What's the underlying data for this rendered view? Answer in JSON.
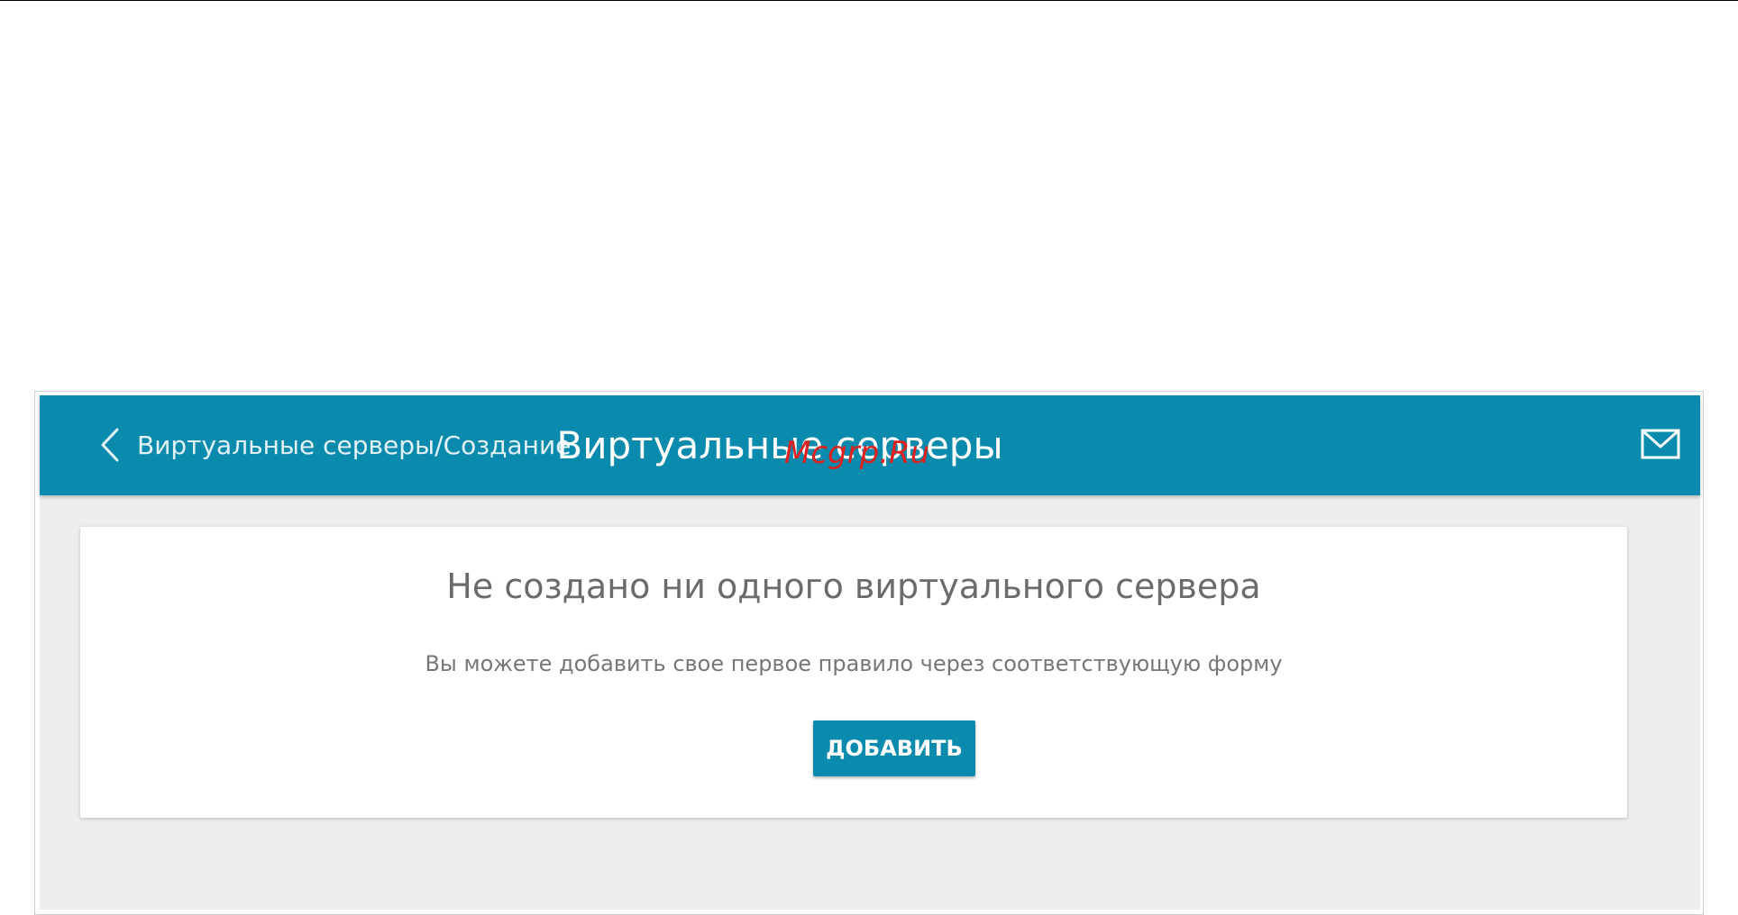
{
  "header": {
    "back_label": "Виртуальные серверы/Создание",
    "title": "Виртуальные серверы",
    "watermark": "Mcgrp.Ru",
    "icons": {
      "back": "chevron-left-icon",
      "mail": "mail-icon"
    }
  },
  "empty_state": {
    "title": "Не создано ни одного виртуального сервера",
    "description": "Вы можете добавить свое первое правило через соответствующую форму",
    "add_button_label": "ДОБАВИТЬ"
  },
  "colors": {
    "accent": "#0a8aac",
    "background": "#eeeeee",
    "card": "#ffffff",
    "watermark": "#e0211d"
  }
}
